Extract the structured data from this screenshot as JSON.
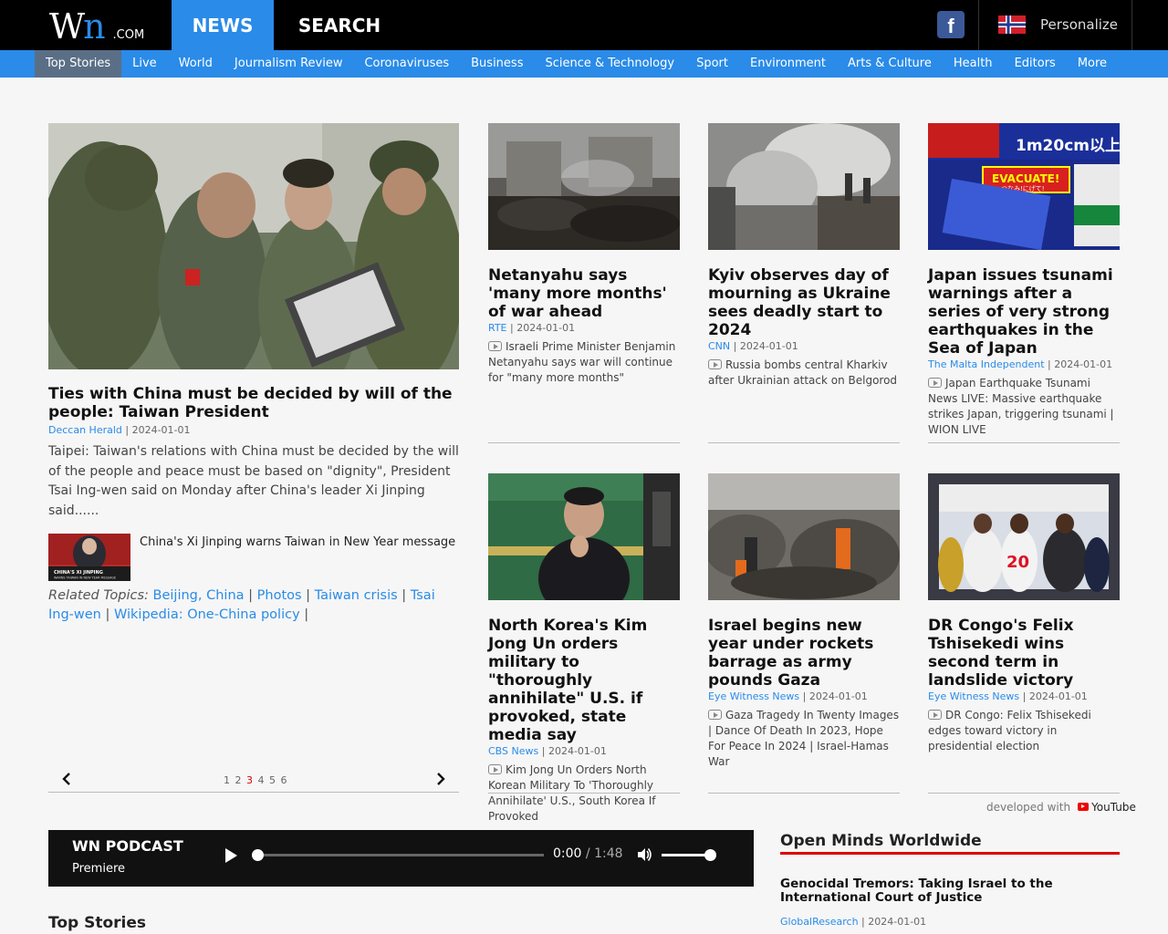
{
  "header": {
    "logo_w": "W",
    "logo_n": "n",
    "logo_com": ".COM",
    "nav_news": "NEWS",
    "nav_search": "SEARCH",
    "fb_glyph": "f",
    "personalize": "Personalize"
  },
  "subnav": [
    "Top Stories",
    "Live",
    "World",
    "Journalism Review",
    "Coronaviruses",
    "Business",
    "Science & Technology",
    "Sport",
    "Environment",
    "Arts & Culture",
    "Health",
    "Editors",
    "More"
  ],
  "lead": {
    "title": "Ties with China must be decided by will of the people: Taiwan President",
    "source": "Deccan Herald",
    "date": "2024-01-01",
    "summary": "Taipei: Taiwan's relations with China must be decided by the will of the people and peace must be based on \"dignity\", President Tsai Ing-wen said on Monday after China's leader Xi Jinping said......",
    "related_text": "China's Xi Jinping warns Taiwan in New Year message",
    "related_thumb_caption": "CHINA'S XI JINPING",
    "related_thumb_caption2": "WARNS TAIWAN IN NEW YEAR MESSAGE",
    "topics_label": "Related Topics:",
    "topics": [
      "Beijing, China",
      "Photos",
      "Taiwan crisis",
      "Tsai Ing-wen",
      "Wikipedia: One-China policy"
    ],
    "separator": "|"
  },
  "pager": {
    "pages": [
      "1",
      "2",
      "3",
      "4",
      "5",
      "6"
    ],
    "current": "3"
  },
  "cards": [
    {
      "title": "Netanyahu says 'many more months' of war ahead",
      "source": "RTE",
      "date": "2024-01-01",
      "desc": "Israeli Prime Minister Benjamin Netanyahu says war will continue for \"many more months\""
    },
    {
      "title": "Kyiv observes day of mourning as Ukraine sees deadly start to 2024",
      "source": "CNN",
      "date": "2024-01-01",
      "desc": "Russia bombs central Kharkiv after Ukrainian attack on Belgorod"
    },
    {
      "title": "Japan issues tsunami warnings after a series of very strong earthquakes in the Sea of Japan",
      "source": "The Malta Independent",
      "date": "2024-01-01",
      "desc": "Japan Earthquake Tsunami News LIVE: Massive earthquake strikes Japan, triggering tsunami | WION LIVE"
    },
    {
      "title": "North Korea's Kim Jong Un orders military to \"thoroughly annihilate\" U.S. if provoked, state media say",
      "source": "CBS News",
      "date": "2024-01-01",
      "desc": "Kim Jong Un Orders North Korean Military To 'Thoroughly Annihilate' U.S., South Korea If Provoked"
    },
    {
      "title": "Israel begins new year under rockets barrage as army pounds Gaza",
      "source": "Eye Witness News",
      "date": "2024-01-01",
      "desc": "Gaza Tragedy In Twenty Images | Dance Of Death In 2023, Hope For Peace In 2024 | Israel-Hamas War"
    },
    {
      "title": "DR Congo's Felix Tshisekedi wins second term in landslide victory",
      "source": "Eye Witness News",
      "date": "2024-01-01",
      "desc": "DR Congo: Felix Tshisekedi edges toward victory in presidential election"
    }
  ],
  "tsunami_banner": {
    "top": "1m20cm以上",
    "evac": "EVACUATE!",
    "evac_sub": "つなみ!にげて!"
  },
  "developed": {
    "label": "developed with",
    "brand": "YouTube"
  },
  "podcast": {
    "title": "WN PODCAST",
    "subtitle": "Premiere",
    "time_current": "0:00",
    "time_sep": "/",
    "time_total": "1:48",
    "progress": 0.0,
    "volume": 1.0
  },
  "top_stories_heading": "Top Stories",
  "open_minds": {
    "heading": "Open Minds Worldwide",
    "item_title": "Genocidal Tremors: Taking Israel to the International Court of Justice",
    "source": "GlobalResearch",
    "date": "2024-01-01"
  },
  "colors": {
    "brand_blue": "#2a8be8",
    "accent_red": "#dd0000",
    "header_bg": "#000000"
  },
  "icons": {
    "facebook": "facebook-icon",
    "flag": "norway-flag-icon",
    "video": "video-icon",
    "prev": "chevron-left-icon",
    "next": "chevron-right-icon",
    "play": "play-icon",
    "volume": "volume-icon",
    "youtube": "youtube-icon"
  }
}
